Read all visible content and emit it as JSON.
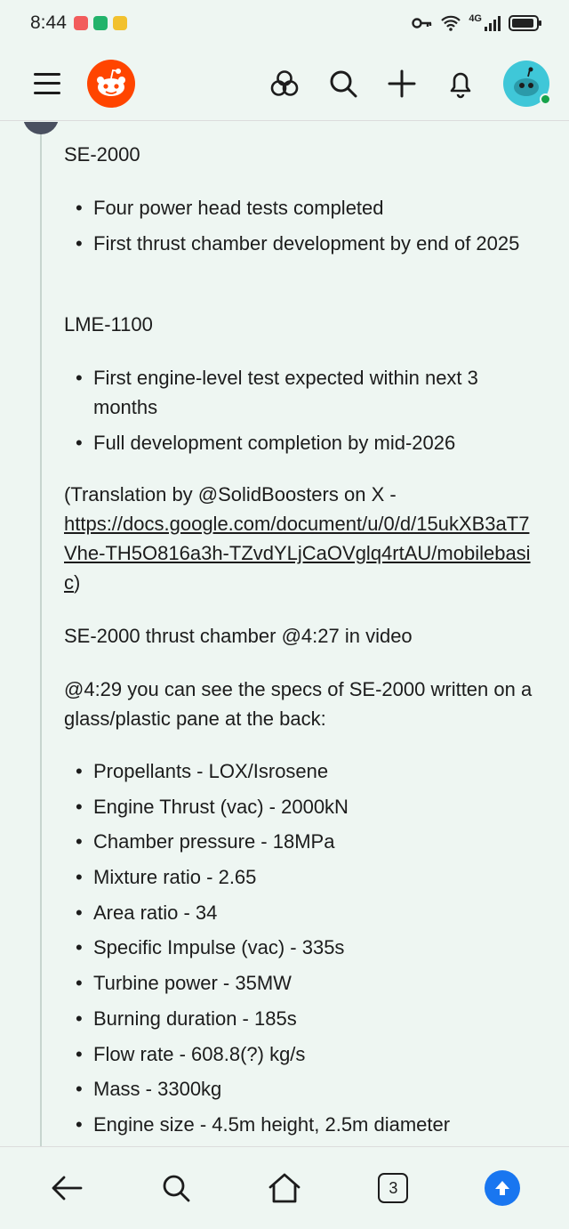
{
  "status_bar": {
    "time": "8:44",
    "icons": [
      "key-icon",
      "wifi-icon",
      "signal-icon",
      "battery-icon"
    ],
    "network": "4G"
  },
  "header": {
    "icons": [
      "menu-icon",
      "reddit-logo",
      "community-icon",
      "search-icon",
      "create-icon",
      "notification-icon",
      "avatar"
    ]
  },
  "post": {
    "se2000_heading": "SE-2000",
    "se2000_items": [
      "Four power head tests completed",
      "First thrust chamber development by end of 2025"
    ],
    "lme1100_heading": "LME-1100",
    "lme1100_items": [
      "First engine-level test expected within next 3 months",
      "Full development completion by mid-2026"
    ],
    "translation_prefix": "(Translation by @SolidBoosters on X -",
    "translation_link": "https://docs.google.com/document/u/0/d/15ukXB3aT7Vhe-TH5O816a3h-TZvdYLjCaOVglq4rtAU/mobilebasic",
    "translation_suffix": ")",
    "chamber_line": "SE-2000 thrust chamber @4:27 in video",
    "specs_intro": "@4:29 you can see the specs of SE-2000 written on a glass/plastic pane at the back:",
    "specs": [
      "Propellants - LOX/Isrosene",
      "Engine Thrust (vac) - 2000kN",
      "Chamber pressure - 18MPa",
      "Mixture ratio - 2.65",
      "Area ratio - 34",
      "Specific Impulse (vac) - 335s",
      "Turbine power - 35MW",
      "Burning duration - 185s",
      "Flow rate - 608.8(?) kg/s",
      "Mass - 3300kg",
      "Engine size - 4.5m height, 2.5m diameter"
    ]
  },
  "bottom_nav": {
    "tabs_count": "3"
  },
  "colors": {
    "background": "#eef6f2",
    "reddit_orange": "#ff4500",
    "scroll_top_blue": "#1976f0",
    "avatar_teal": "#3fc7d8",
    "online_green": "#16a34a"
  }
}
